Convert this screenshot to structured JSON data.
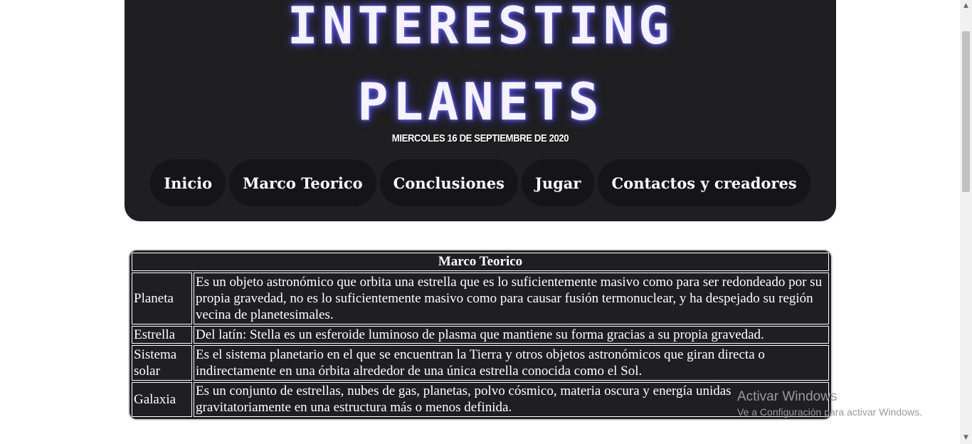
{
  "header": {
    "title_line1": "INTERESTING",
    "title_line2": "PLANETS",
    "date": "MIERCOLES 16 DE SEPTIEMBRE DE 2020"
  },
  "nav": {
    "items": [
      {
        "label": "Inicio"
      },
      {
        "label": "Marco Teorico"
      },
      {
        "label": "Conclusiones"
      },
      {
        "label": "Jugar"
      },
      {
        "label": "Contactos y creadores"
      }
    ]
  },
  "table": {
    "caption": "Marco Teorico",
    "rows": [
      {
        "term": "Planeta",
        "definition": "Es un objeto astronómico que orbita una estrella que es lo suficientemente masivo como para ser redondeado por su propia gravedad, no es lo suficientemente masivo como para causar fusión termonuclear, y ha despejado su región vecina de planetesimales."
      },
      {
        "term": "Estrella",
        "definition": "Del latín: Stella es un esferoide luminoso de plasma que mantiene su forma gracias a su propia gravedad."
      },
      {
        "term": "Sistema solar",
        "definition": "Es el sistema planetario en el que se encuentran la Tierra y otros objetos astronómicos que giran directa o indirectamente en una órbita alrededor de una única estrella conocida como el Sol."
      },
      {
        "term": "Galaxia",
        "definition": "Es un conjunto de estrellas, nubes de gas, planetas, polvo cósmico, materia oscura y energía unidas gravitatoriamente en una estructura más o menos definida."
      }
    ]
  },
  "watermark": {
    "line1": "Activar Windows",
    "line2": "Ve a Configuración para activar Windows."
  },
  "scrollbar": {
    "up_icon": "triangle-up",
    "down_icon": "triangle-down"
  }
}
